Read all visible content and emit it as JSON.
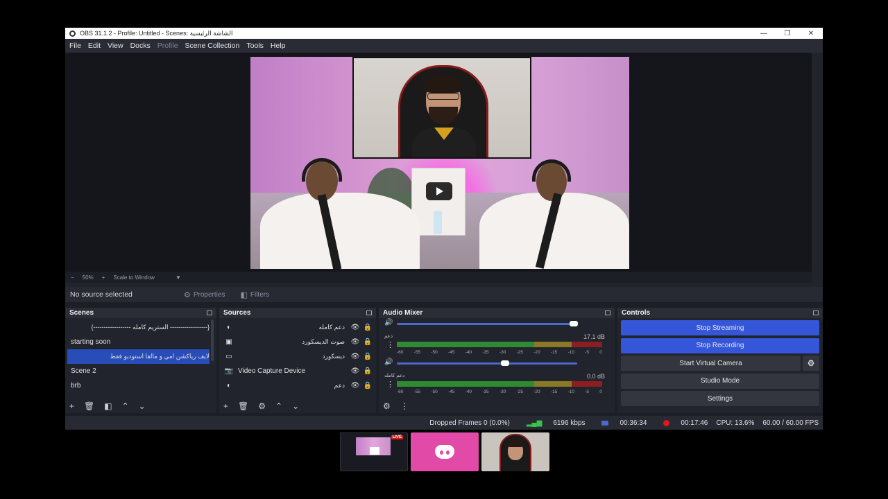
{
  "window": {
    "title": "OBS 31.1.2 - Profile: Untitled - Scenes: الشاشة الرئيسية",
    "controls": {
      "minimize": "—",
      "restore": "❐",
      "close": "✕"
    }
  },
  "menu": [
    "File",
    "Edit",
    "View",
    "Docks",
    "Profile",
    "Scene Collection",
    "Tools",
    "Help"
  ],
  "preview": {
    "zoom_minus": "−",
    "zoom_level": "50%",
    "zoom_plus": "+",
    "scale_mode": "Scale to Window",
    "scale_caret": "▼"
  },
  "source_toolbar": {
    "no_source": "No source selected",
    "properties": "Properties",
    "filters": "Filters"
  },
  "scenes": {
    "title": "Scenes",
    "items": [
      "{------------------ الستريم كامله ------------------}",
      "starting soon",
      "لايف رياكشن امي و مالقا  استوديو فقط",
      "Scene 2",
      "brb"
    ],
    "selected_index": 2
  },
  "sources": {
    "title": "Sources",
    "items": [
      {
        "name": "دعم كامله",
        "icon": "audio-icon"
      },
      {
        "name": "صوت الديسكورد",
        "icon": "window-capture-icon"
      },
      {
        "name": "ديسكورد",
        "icon": "display-icon"
      },
      {
        "name": "Video Capture Device",
        "icon": "camera-icon"
      },
      {
        "name": "دعم",
        "icon": "audio-icon"
      }
    ]
  },
  "audio_mixer": {
    "title": "Audio Mixer",
    "channels": [
      {
        "name": "دعم",
        "db": "17.1 dB",
        "volume": 0.98
      },
      {
        "name": "دعم كامله",
        "db": "0.0 dB",
        "volume": 0.6
      }
    ],
    "ticks": [
      "-60",
      "-55",
      "-50",
      "-45",
      "-40",
      "-35",
      "-30",
      "-25",
      "-20",
      "-15",
      "-10",
      "-5",
      "0"
    ]
  },
  "controls": {
    "title": "Controls",
    "stop_streaming": "Stop Streaming",
    "stop_recording": "Stop Recording",
    "start_virtual_camera": "Start Virtual Camera",
    "studio_mode": "Studio Mode",
    "settings": "Settings"
  },
  "status": {
    "dropped_frames": "Dropped Frames 0 (0.0%)",
    "bitrate": "6196 kbps",
    "stream_time": "00:36:34",
    "record_time": "00:17:46",
    "cpu": "CPU: 13.6%",
    "fps": "60.00 / 60.00 FPS"
  },
  "taskbar": {
    "live_badge": "LIVE"
  },
  "colors": {
    "accent_blue": "#3556d8",
    "selected_scene": "#284cb8",
    "record_red": "#e01818",
    "discord_pink": "#e24aa8"
  }
}
